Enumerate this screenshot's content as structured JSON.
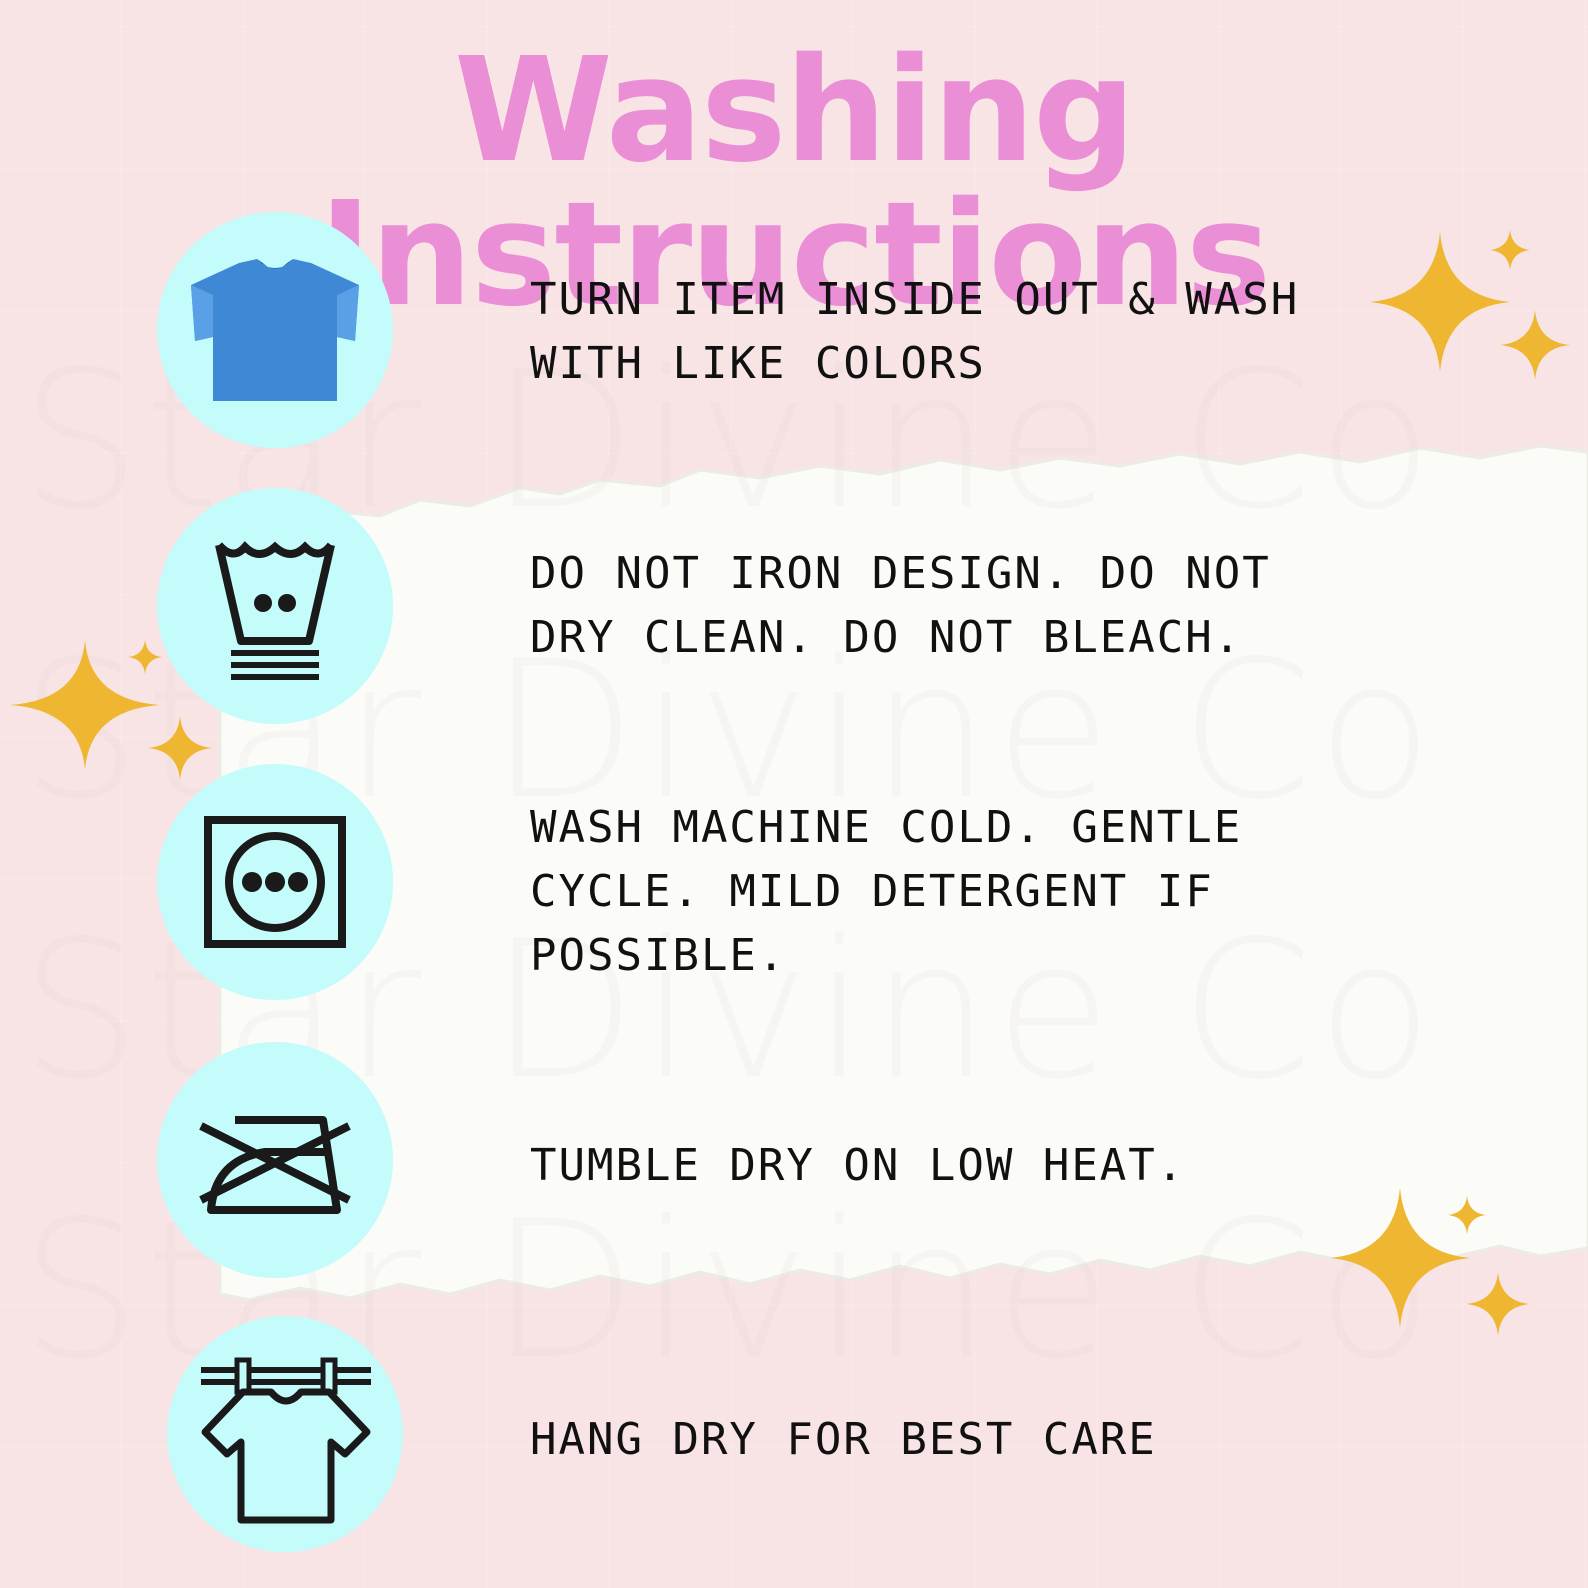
{
  "title": "Washing Instructions",
  "watermark": "Star Divine Co",
  "colors": {
    "background": "#f8e4e5",
    "title": "#ea8ed6",
    "icon_circle": "#c4fbfb",
    "shirt_icon": "#3f88d6",
    "sparkle": "#efb631",
    "text": "#111111",
    "paper": "#fbfbf8"
  },
  "items": [
    {
      "icon": "tshirt-icon",
      "text": "TURN ITEM INSIDE OUT & WASH\nWITH LIKE COLORS"
    },
    {
      "icon": "wash-basin-cold-gentle-icon",
      "text": "DO NOT IRON DESIGN. DO NOT\nDRY CLEAN. DO NOT BLEACH."
    },
    {
      "icon": "tumble-dry-low-icon",
      "text": "WASH MACHINE COLD. GENTLE\nCYCLE. MILD DETERGENT IF\nPOSSIBLE."
    },
    {
      "icon": "do-not-iron-icon",
      "text": "TUMBLE DRY ON LOW HEAT."
    },
    {
      "icon": "hang-dry-icon",
      "text": "HANG DRY FOR BEST CARE"
    }
  ]
}
